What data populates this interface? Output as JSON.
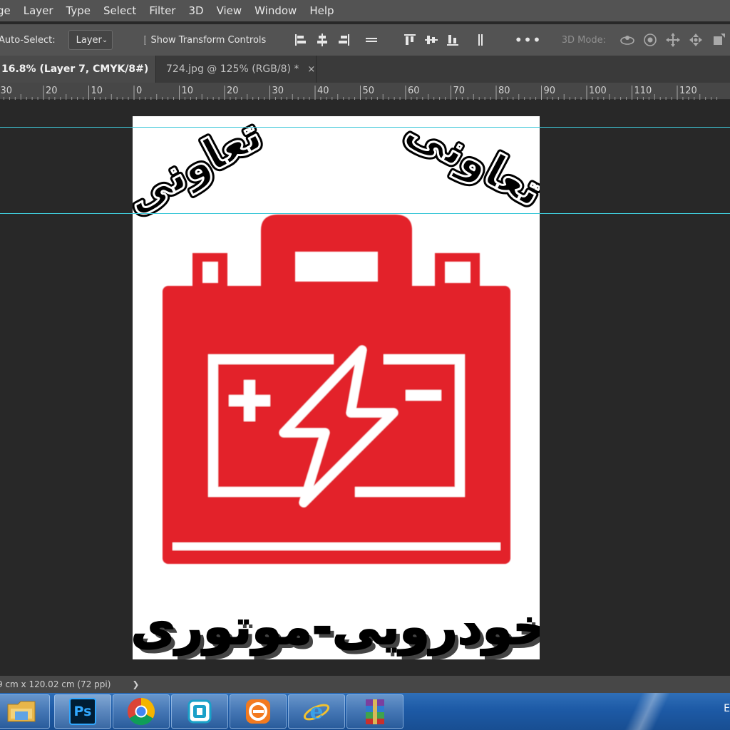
{
  "menubar": {
    "items": [
      "ge",
      "Layer",
      "Type",
      "Select",
      "Filter",
      "3D",
      "View",
      "Window",
      "Help"
    ]
  },
  "options": {
    "auto_select_label": "Auto-Select:",
    "layer_select_value": "Layer",
    "show_transform_label": "Show Transform Controls",
    "mode_3d_label": "3D Mode:"
  },
  "tabs": [
    {
      "label": "16.8% (Layer 7, CMYK/8#)",
      "close": "×",
      "active": true
    },
    {
      "label": "724.jpg @ 125% (RGB/8) *",
      "close": "×",
      "active": false
    }
  ],
  "ruler": {
    "labels": [
      "30",
      "20",
      "10",
      "0",
      "10",
      "20",
      "30",
      "40",
      "50",
      "60",
      "70",
      "80",
      "90",
      "100",
      "110",
      "120"
    ]
  },
  "canvas": {
    "top_left_word": "تعاونی",
    "top_right_word": "تعاونی",
    "bottom_text": "خودرویی-موتوری",
    "battery_icon": "battery-lightning-icon",
    "battery_color": "#e3212b"
  },
  "status": {
    "doc_size": "9 cm x 120.02 cm (72 ppi)",
    "arrow": "❯"
  },
  "taskbar": {
    "apps": [
      "file-explorer-icon",
      "photoshop-icon",
      "chrome-icon",
      "outlook-icon",
      "uc-browser-icon",
      "internet-explorer-icon",
      "winrar-icon"
    ],
    "photoshop_label": "Ps",
    "tray_text": "E"
  },
  "colors": {
    "menubar": "#535353",
    "workspace": "#282828",
    "guide": "#3fc8d8",
    "taskbar": "#1d5aa6"
  }
}
